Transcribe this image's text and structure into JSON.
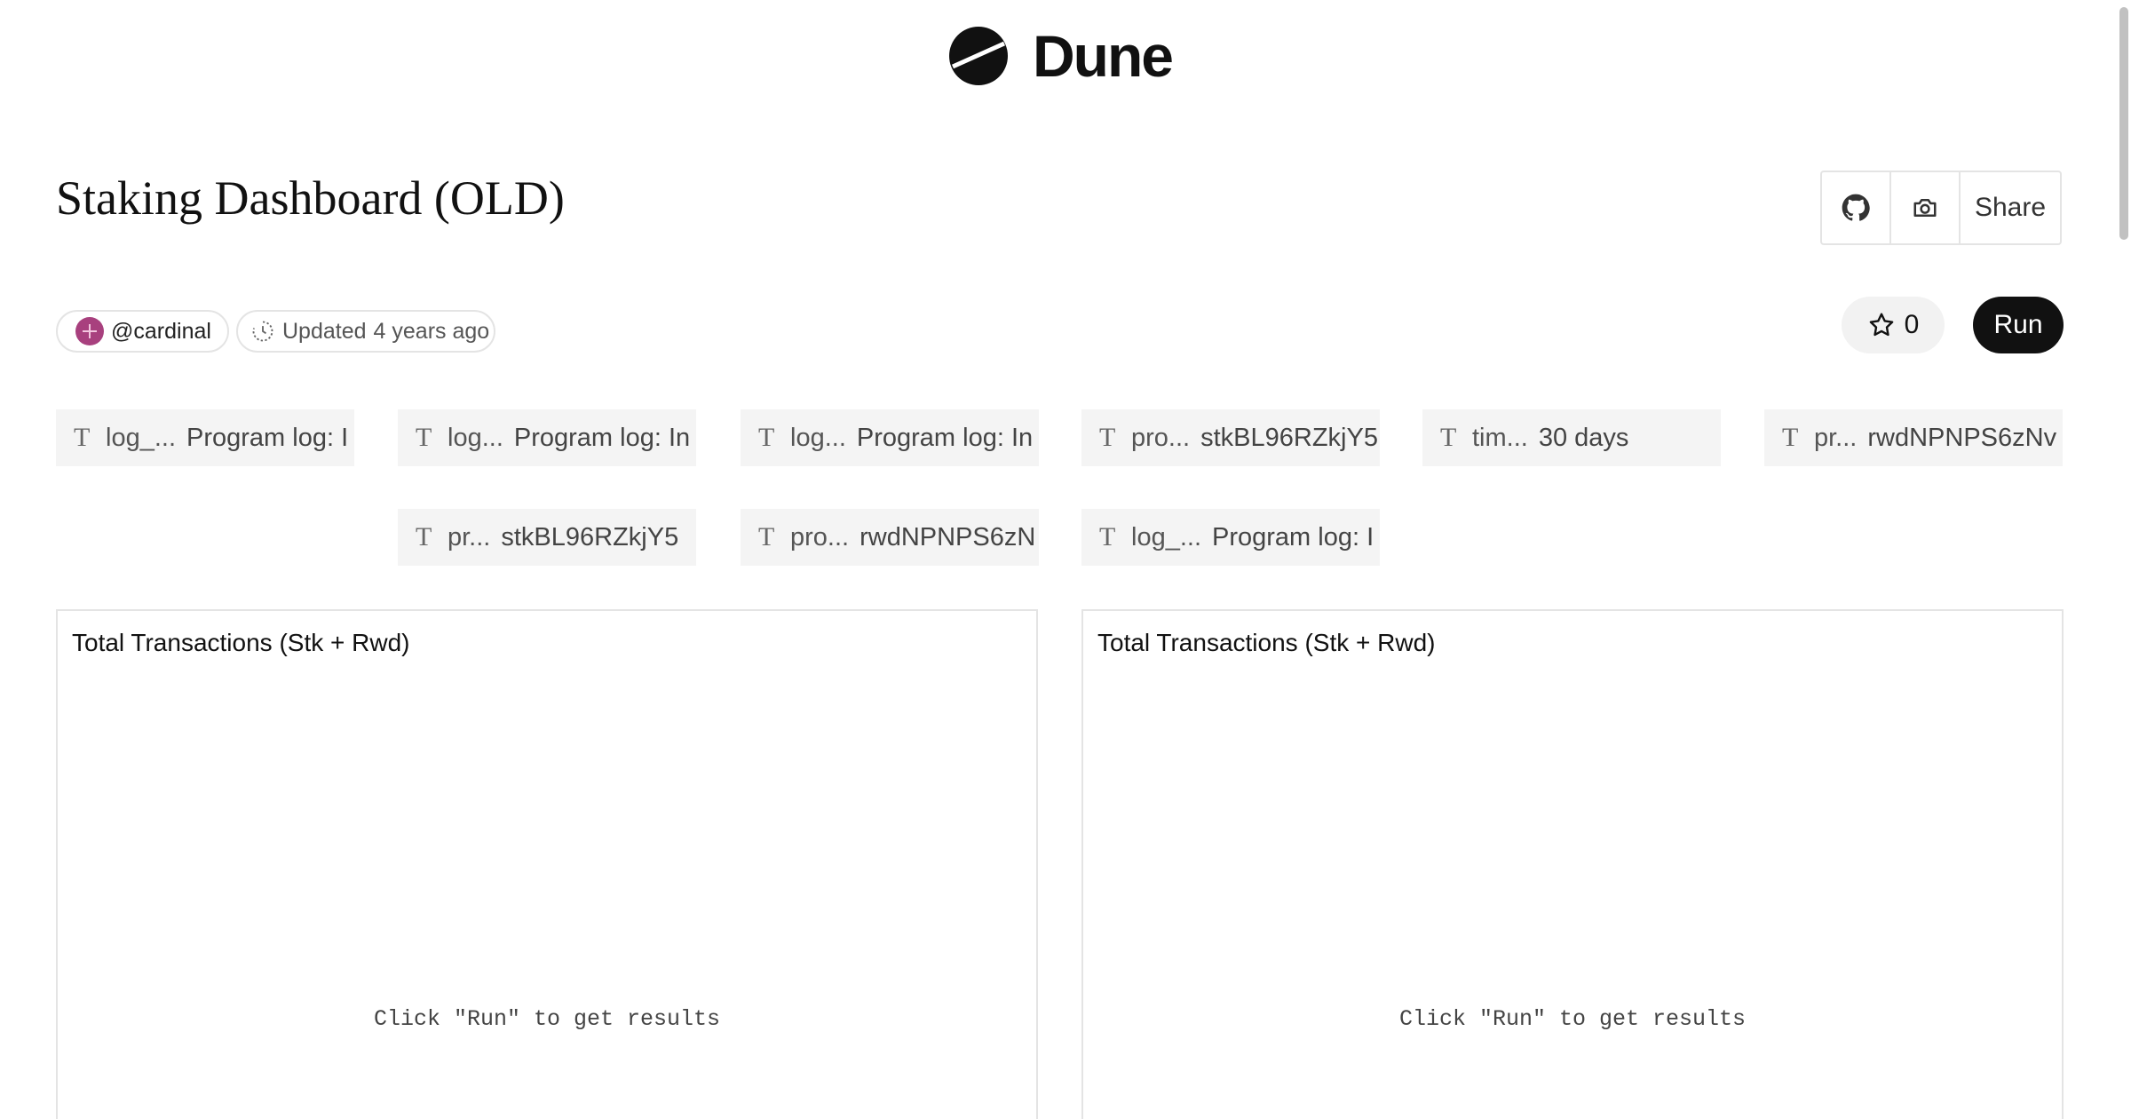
{
  "brand": {
    "name": "Dune"
  },
  "dashboard": {
    "title": "Staking Dashboard (OLD)",
    "owner": "@cardinal",
    "updated_label": "Updated",
    "updated_value": "4 years ago",
    "star_count": "0"
  },
  "actions": {
    "share_label": "Share",
    "run_label": "Run"
  },
  "parameters": [
    {
      "name": "log_...",
      "value": "Program log: I"
    },
    {
      "name": "log...",
      "value": "Program log: In"
    },
    {
      "name": "log...",
      "value": "Program log: In"
    },
    {
      "name": "pro...",
      "value": "stkBL96RZkjY5"
    },
    {
      "name": "tim...",
      "value": "30 days"
    },
    {
      "name": "pr...",
      "value": "rwdNPNPS6zNv"
    },
    {
      "name": "pr...",
      "value": "stkBL96RZkjY5"
    },
    {
      "name": "pro...",
      "value": "rwdNPNPS6zN"
    },
    {
      "name": "log_...",
      "value": "Program log: I"
    }
  ],
  "panels": [
    {
      "title": "Total Transactions (Stk + Rwd)",
      "message": "Click \"Run\" to get results"
    },
    {
      "title": "Total Transactions (Stk + Rwd)",
      "message": "Click \"Run\" to get results"
    }
  ],
  "colors": {
    "accent": "#111111",
    "avatar": "#a8407e",
    "param_bg": "#f4f4f4",
    "border": "#e4e4e4"
  },
  "icons": {
    "logo": "dune-logo-icon",
    "github": "github-icon",
    "camera": "camera-icon",
    "star": "star-icon",
    "history": "history-icon",
    "param_type": "text-type-icon"
  }
}
